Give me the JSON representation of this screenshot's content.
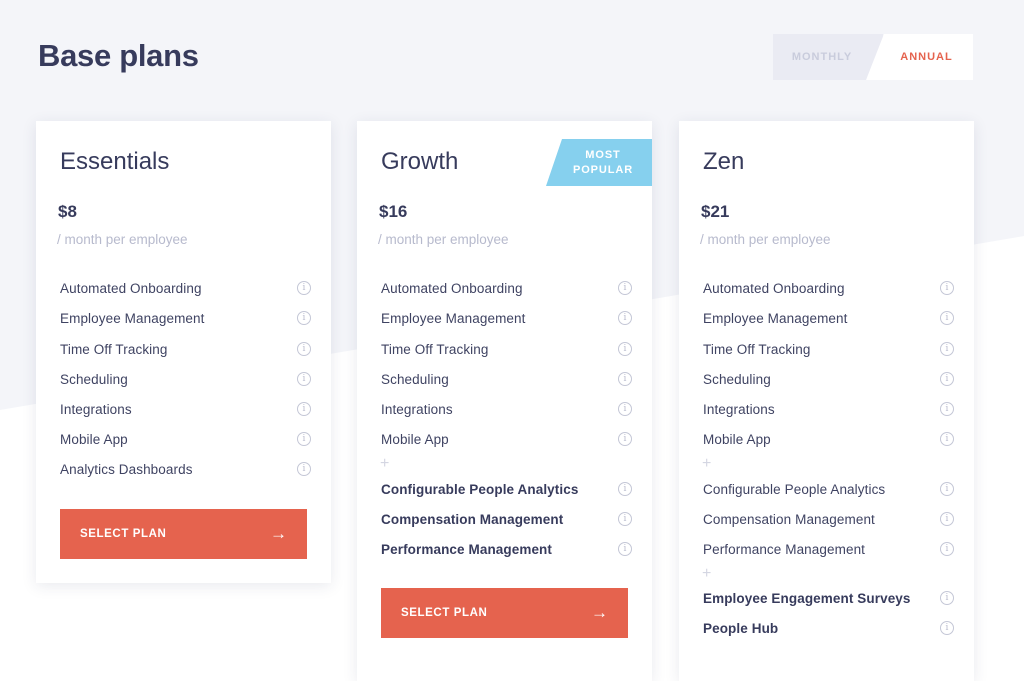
{
  "page": {
    "title": "Base plans"
  },
  "billing_toggle": {
    "monthly": "MONTHLY",
    "annual": "ANNUAL",
    "selected": "ANNUAL"
  },
  "colors": {
    "accent": "#e5634e",
    "badge": "#86d0ee",
    "text": "#373b5c",
    "muted": "#b7bacd",
    "background_band": "#f4f5f9"
  },
  "icons": {
    "info": "info-circle-icon",
    "plus": "plus-icon",
    "arrow": "arrow-right-icon"
  },
  "plans": [
    {
      "name": "Essentials",
      "price": "$8",
      "period": "/ month per employee",
      "badge": "",
      "features": [
        "Automated Onboarding",
        "Employee Management",
        "Time Off Tracking",
        "Scheduling",
        "Integrations",
        "Mobile App",
        "Analytics Dashboards"
      ],
      "button": "SELECT PLAN"
    },
    {
      "name": "Growth",
      "price": "$16",
      "period": "/ month per employee",
      "badge": {
        "line1": "MOST",
        "line2": "POPULAR"
      },
      "features": [
        "Automated Onboarding",
        "Employee Management",
        "Time Off Tracking",
        "Scheduling",
        "Integrations",
        "Mobile App"
      ],
      "extra_features": [
        "Configurable People Analytics",
        "Compensation Management",
        "Performance Management"
      ],
      "button": "SELECT PLAN"
    },
    {
      "name": "Zen",
      "price": "$21",
      "period": "/ month per employee",
      "badge": "",
      "features": [
        "Automated Onboarding",
        "Employee Management",
        "Time Off Tracking",
        "Scheduling",
        "Integrations",
        "Mobile App"
      ],
      "extra_features": [
        "Configurable People Analytics",
        "Compensation Management",
        "Performance Management"
      ],
      "extra_features_2": [
        "Employee Engagement Surveys",
        "People Hub"
      ]
    }
  ]
}
